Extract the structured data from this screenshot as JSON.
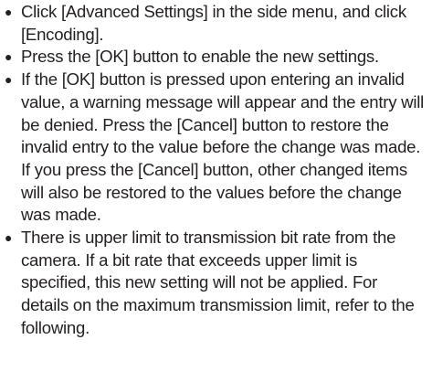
{
  "notes": {
    "items": [
      {
        "bullet": "●",
        "text": "Click [Advanced Settings] in the side menu, and click [Encoding]."
      },
      {
        "bullet": "●",
        "text": "Press the [OK] button to enable the new settings."
      },
      {
        "bullet": "●",
        "text": "If the [OK] button is pressed upon entering an invalid value, a warning message will appear and the entry will be denied. Press the [Cancel] button to restore the invalid entry to the value before the change was made. If you press the [Cancel] button, other changed items will also be restored to the values before the change was made."
      },
      {
        "bullet": "●",
        "text": "There is upper limit to transmission bit rate from the camera. If a bit rate that exceeds upper limit is specified, this new setting will not be applied. For details on the maximum transmission limit, refer to the following."
      }
    ]
  }
}
